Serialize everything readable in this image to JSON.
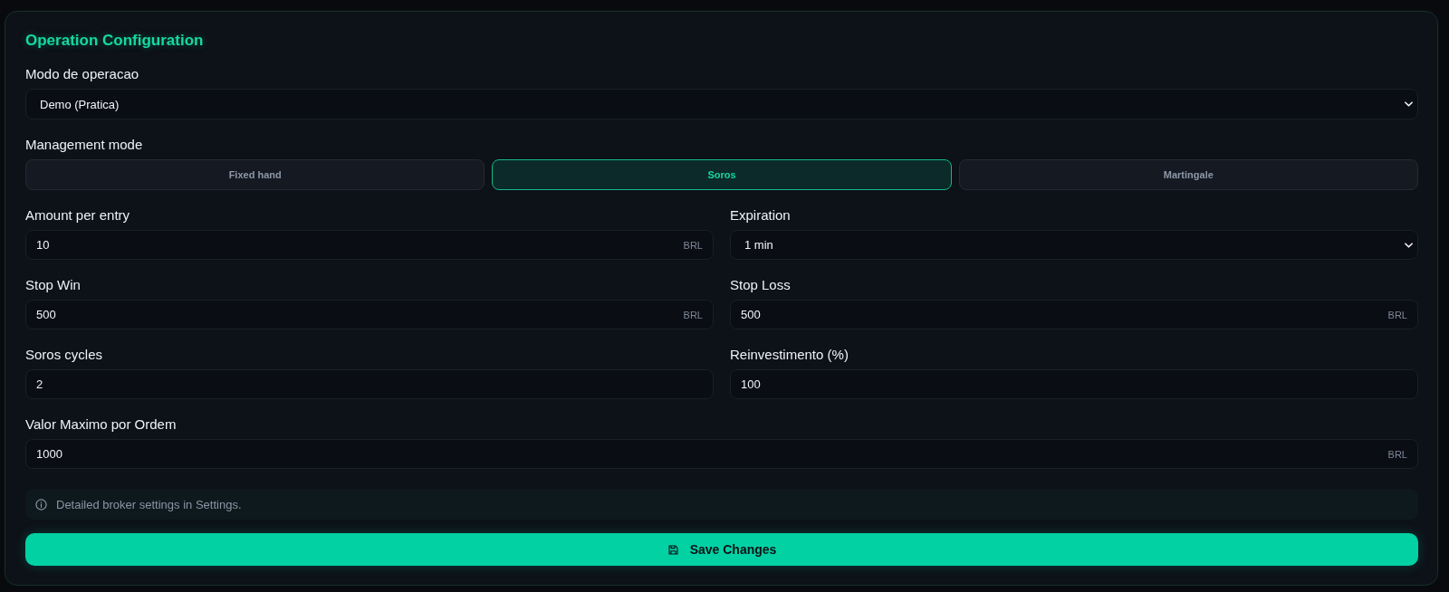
{
  "title": "Operation Configuration",
  "operation_mode": {
    "label": "Modo de operacao",
    "kind": "select",
    "value": "Demo (Pratica)"
  },
  "management_mode": {
    "label": "Management mode",
    "options": [
      {
        "label": "Fixed hand",
        "selected": false
      },
      {
        "label": "Soros",
        "selected": true
      },
      {
        "label": "Martingale",
        "selected": false
      }
    ]
  },
  "fields": [
    {
      "label": "Amount per entry",
      "kind": "input",
      "value": "10",
      "suffix": "BRL"
    },
    {
      "label": "Expiration",
      "kind": "select",
      "value": "1 min"
    },
    {
      "label": "Stop Win",
      "kind": "input",
      "value": "500",
      "suffix": "BRL"
    },
    {
      "label": "Stop Loss",
      "kind": "input",
      "value": "500",
      "suffix": "BRL"
    },
    {
      "label": "Soros cycles",
      "kind": "input",
      "value": "2"
    },
    {
      "label": "Reinvestimento (%)",
      "kind": "input",
      "value": "100"
    }
  ],
  "max_order_field": {
    "label": "Valor Maximo por Ordem",
    "kind": "input",
    "value": "1000",
    "suffix": "BRL"
  },
  "info_note": {
    "text": "Detailed broker settings in Settings."
  },
  "save_button": {
    "label": "Save Changes"
  }
}
